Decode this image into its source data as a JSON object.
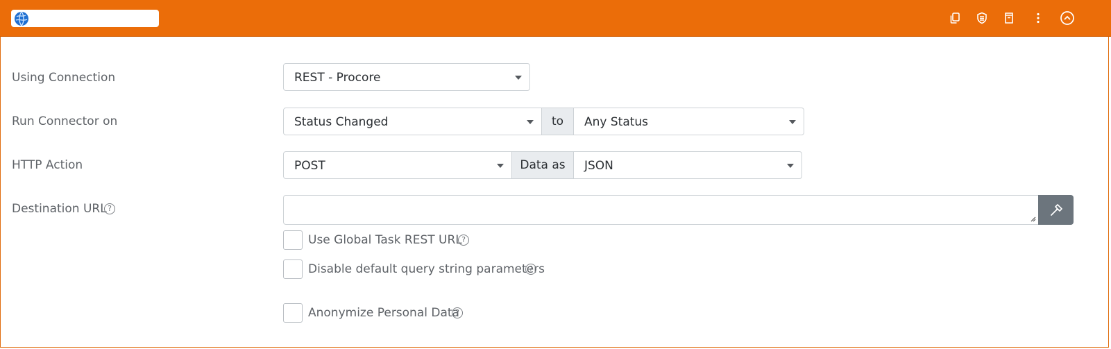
{
  "header": {
    "title": "",
    "colors": {
      "bar": "#eb6d09",
      "icon": "#ffffff"
    },
    "tools": [
      {
        "name": "copy-icon"
      },
      {
        "name": "shield-icon"
      },
      {
        "name": "document-icon"
      },
      {
        "name": "more-vertical-icon"
      },
      {
        "name": "collapse-up-icon"
      }
    ]
  },
  "form": {
    "connection": {
      "label": "Using Connection",
      "value": "REST - Procore"
    },
    "run_on": {
      "label": "Run Connector on",
      "trigger_value": "Status Changed",
      "addon": "to",
      "status_value": "Any Status"
    },
    "http": {
      "label": "HTTP Action",
      "method_value": "POST",
      "addon": "Data as",
      "format_value": "JSON"
    },
    "destination": {
      "label": "Destination URL",
      "help": "?",
      "value": "",
      "button_icon": "hammer-icon"
    },
    "options": [
      {
        "label": "Use Global Task REST URL",
        "checked": false,
        "help": "?"
      },
      {
        "label": "Disable default query string parameters",
        "checked": false,
        "help": "?"
      },
      {
        "label": "Anonymize Personal Data",
        "checked": false,
        "help": "?"
      }
    ]
  }
}
